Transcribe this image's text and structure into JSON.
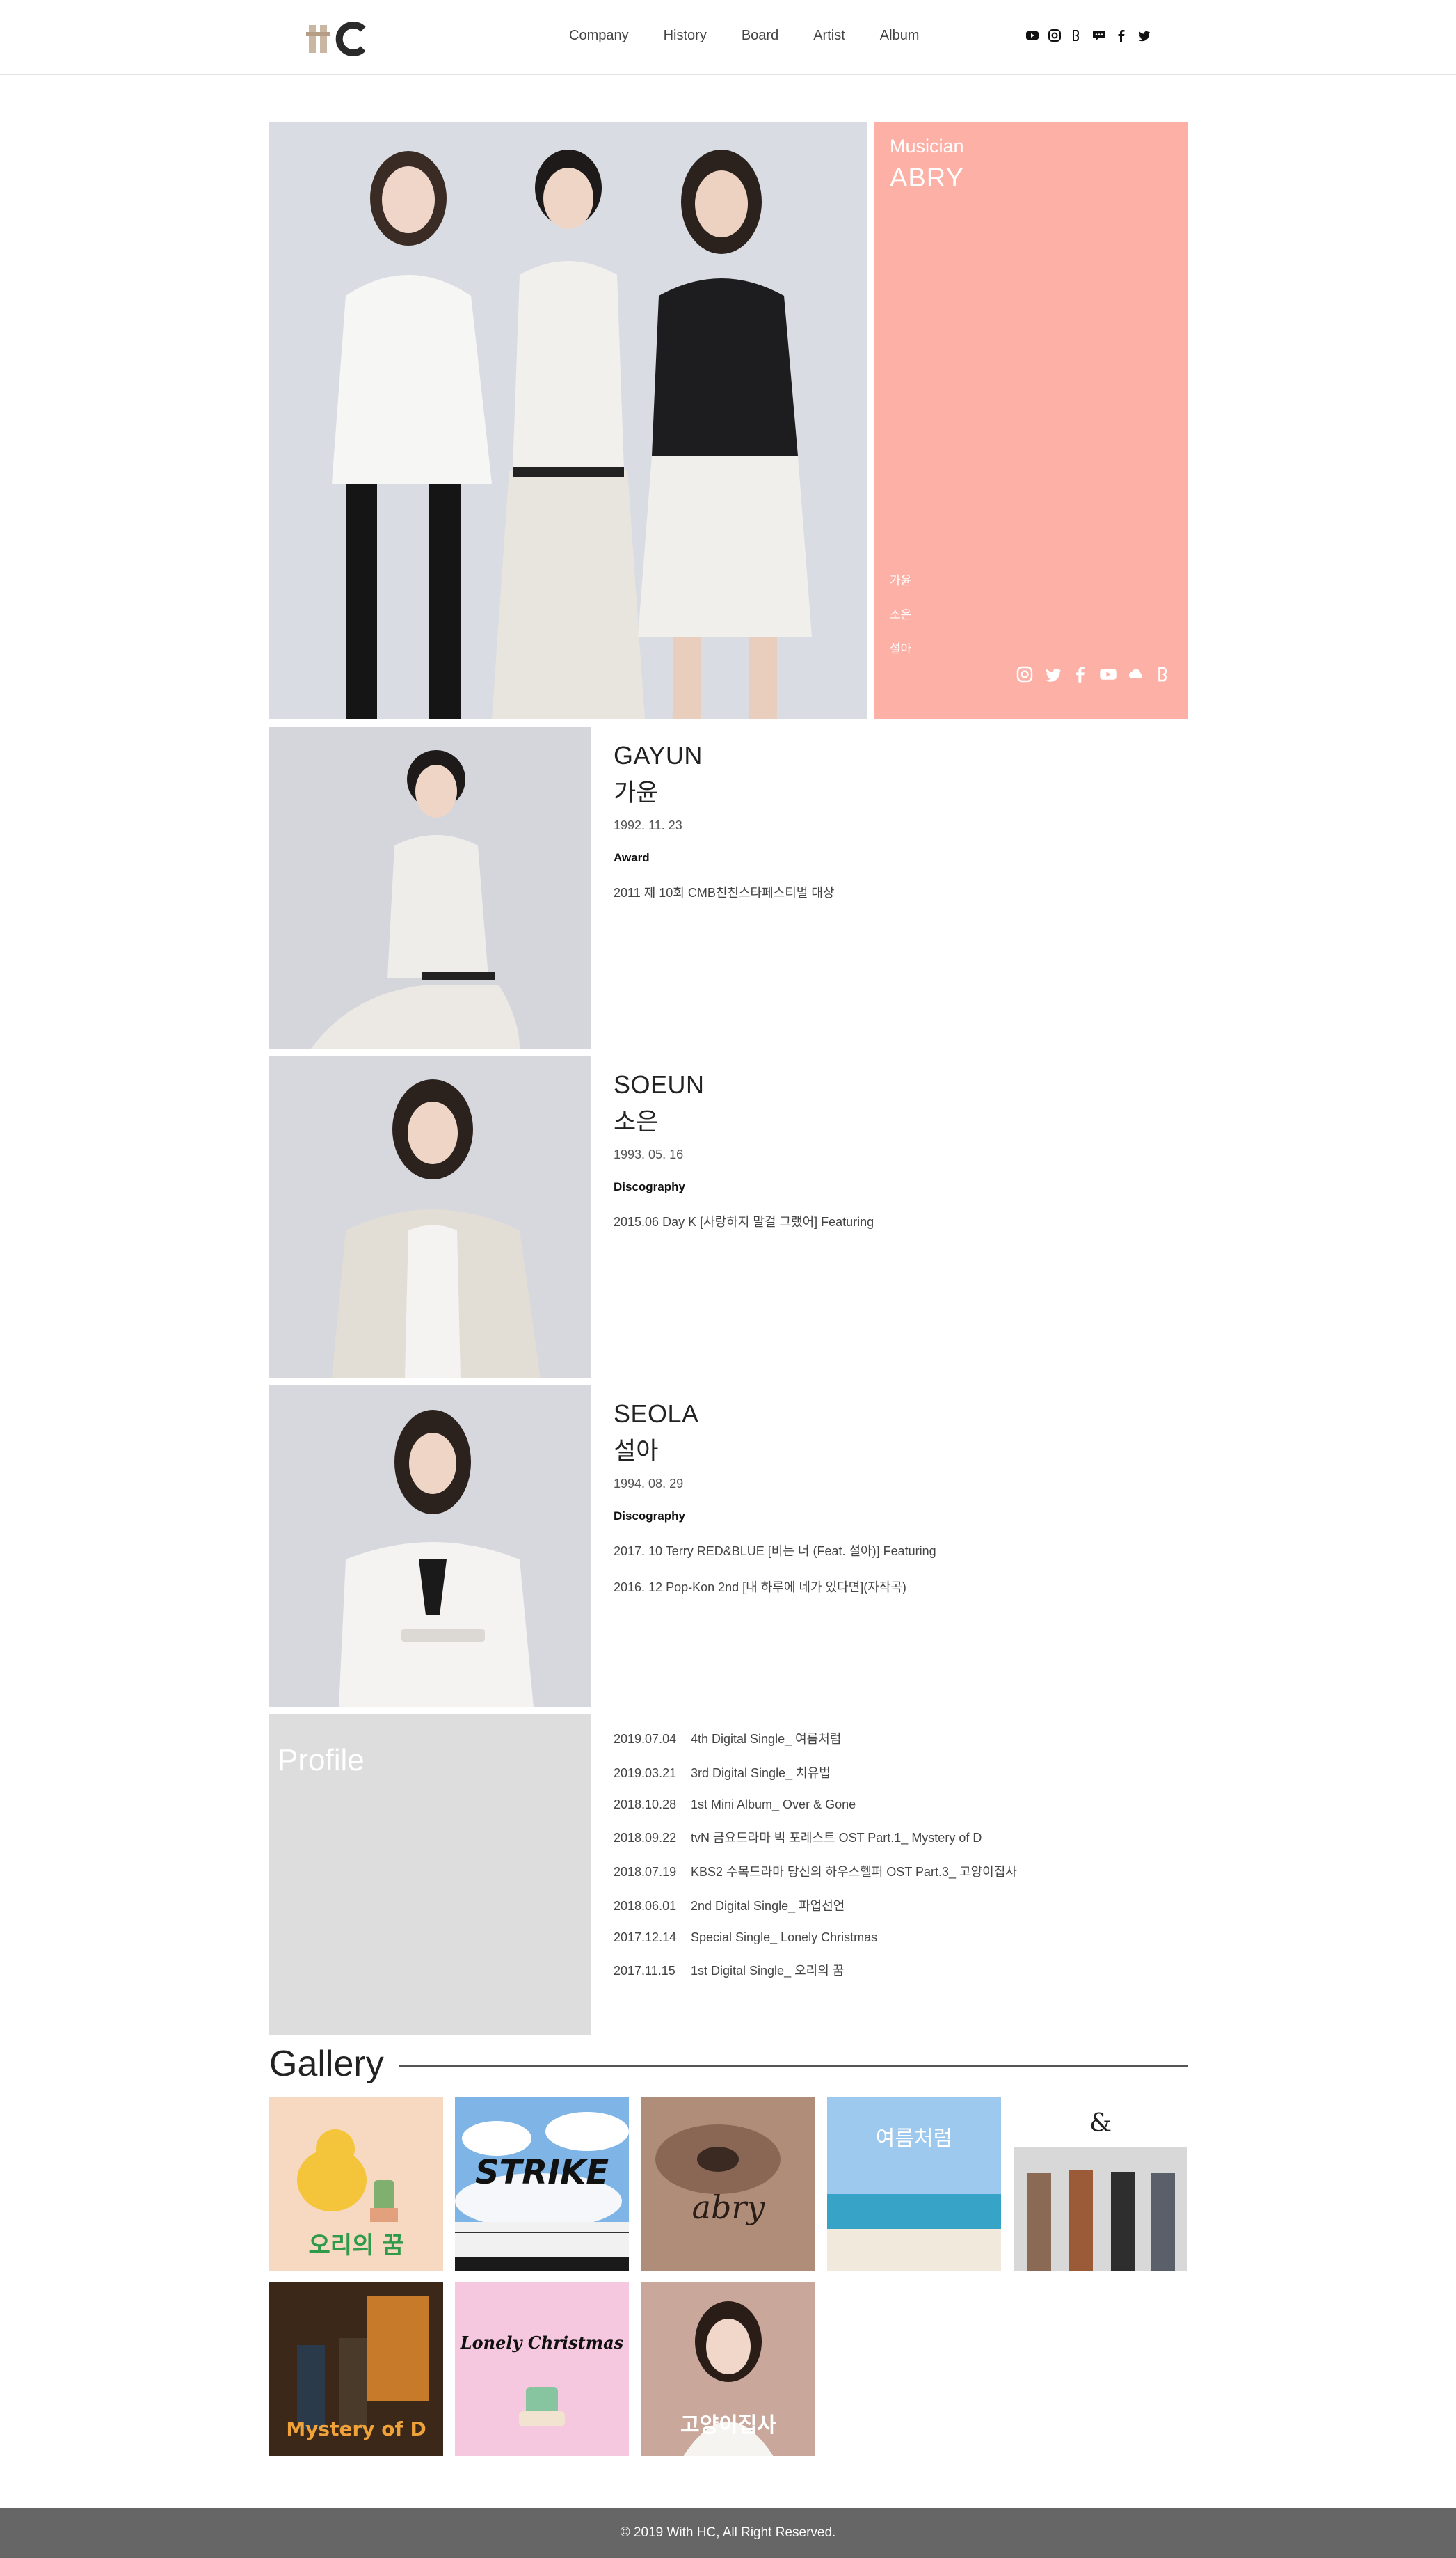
{
  "header": {
    "logo_alt": "HC",
    "nav": [
      "Company",
      "History",
      "Board",
      "Artist",
      "Album"
    ],
    "social": [
      "youtube-icon",
      "instagram-icon",
      "band-icon",
      "chat-icon",
      "facebook-icon",
      "twitter-icon"
    ]
  },
  "hero": {
    "caption": "Musician",
    "name": "ABRY",
    "members": [
      "가윤",
      "소은",
      "설아"
    ],
    "social": [
      "instagram-icon",
      "twitter-icon",
      "facebook-icon",
      "youtube-icon",
      "cloud-icon",
      "band-icon"
    ],
    "panel_color": "#fdb0a6"
  },
  "members": [
    {
      "en": "GAYUN",
      "ko": "가윤",
      "birth": "1992. 11. 23",
      "label": "Award",
      "items": [
        "2011 제 10회 CMB친친스타페스티벌 대상"
      ]
    },
    {
      "en": "SOEUN",
      "ko": "소은",
      "birth": "1993. 05. 16",
      "label": "Discography",
      "items": [
        "2015.06 Day K [사랑하지 말걸 그랬어] Featuring"
      ]
    },
    {
      "en": "SEOLA",
      "ko": "설아",
      "birth": "1994. 08. 29",
      "label": "Discography",
      "items": [
        "2017. 10 Terry RED&BLUE [비는 너 (Feat. 설아)] Featuring",
        "2016. 12 Pop-Kon 2nd [내 하루에 네가 있다면](자작곡)"
      ]
    }
  ],
  "profile": {
    "title": "Profile",
    "discography": [
      {
        "date": "2019.07.04",
        "title": "4th Digital Single_ 여름처럼"
      },
      {
        "date": "2019.03.21",
        "title": "3rd Digital Single_ 치유법"
      },
      {
        "date": "2018.10.28",
        "title": "1st Mini Album_ Over & Gone"
      },
      {
        "date": "2018.09.22",
        "title": "tvN 금요드라마 빅 포레스트 OST Part.1_ Mystery of D"
      },
      {
        "date": "2018.07.19",
        "title": "KBS2 수목드라마 당신의 하우스헬퍼 OST Part.3_ 고양이집사"
      },
      {
        "date": "2018.06.01",
        "title": "2nd Digital Single_ 파업선언"
      },
      {
        "date": "2017.12.14",
        "title": "Special Single_ Lonely Christmas"
      },
      {
        "date": "2017.11.15",
        "title": "1st Digital Single_ 오리의 꿈"
      }
    ]
  },
  "gallery": {
    "title": "Gallery",
    "covers": [
      {
        "text": "오리의 꿈"
      },
      {
        "text": "STRIKE"
      },
      {
        "text": "abry"
      },
      {
        "text": "여름처럼"
      },
      {
        "text": "&"
      },
      {
        "text": "Mystery of D"
      },
      {
        "text": "Lonely Christmas"
      },
      {
        "text": "고양이집사"
      }
    ]
  },
  "footer": {
    "copyright": "© 2019 With HC, All Right Reserved."
  }
}
